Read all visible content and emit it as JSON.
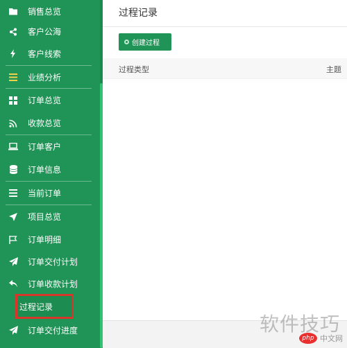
{
  "sidebar": {
    "items": [
      {
        "label": "销售总览",
        "icon": "folder-open-icon"
      },
      {
        "label": "客户公海",
        "icon": "share-icon"
      },
      {
        "label": "客户线索",
        "icon": "bolt-icon"
      },
      {
        "label": "业绩分析",
        "icon": "bars-icon"
      },
      {
        "label": "订单总览",
        "icon": "grid-icon"
      },
      {
        "label": "收款总览",
        "icon": "rss-icon"
      },
      {
        "label": "订单客户",
        "icon": "laptop-icon"
      },
      {
        "label": "订单信息",
        "icon": "database-icon"
      },
      {
        "label": "当前订单",
        "icon": "list-icon"
      },
      {
        "label": "项目总览",
        "icon": "location-arrow-icon"
      },
      {
        "label": "订单明细",
        "icon": "flag-icon"
      },
      {
        "label": "订单交付计划",
        "icon": "paper-plane-icon"
      },
      {
        "label": "订单收款计划",
        "icon": "reply-icon"
      },
      {
        "label": "过程记录",
        "icon": ""
      },
      {
        "label": "订单交付进度",
        "icon": "paper-plane-icon"
      }
    ]
  },
  "main": {
    "title": "过程记录",
    "create_button": "创建过程",
    "columns": [
      "过程类型",
      "主题"
    ]
  },
  "watermark": {
    "text": "软件技巧",
    "site_badge": "php",
    "site_label": "中文网"
  },
  "colors": {
    "sidebar": "#1f9456",
    "accent": "#1f9456",
    "highlight": "#d9362b"
  }
}
